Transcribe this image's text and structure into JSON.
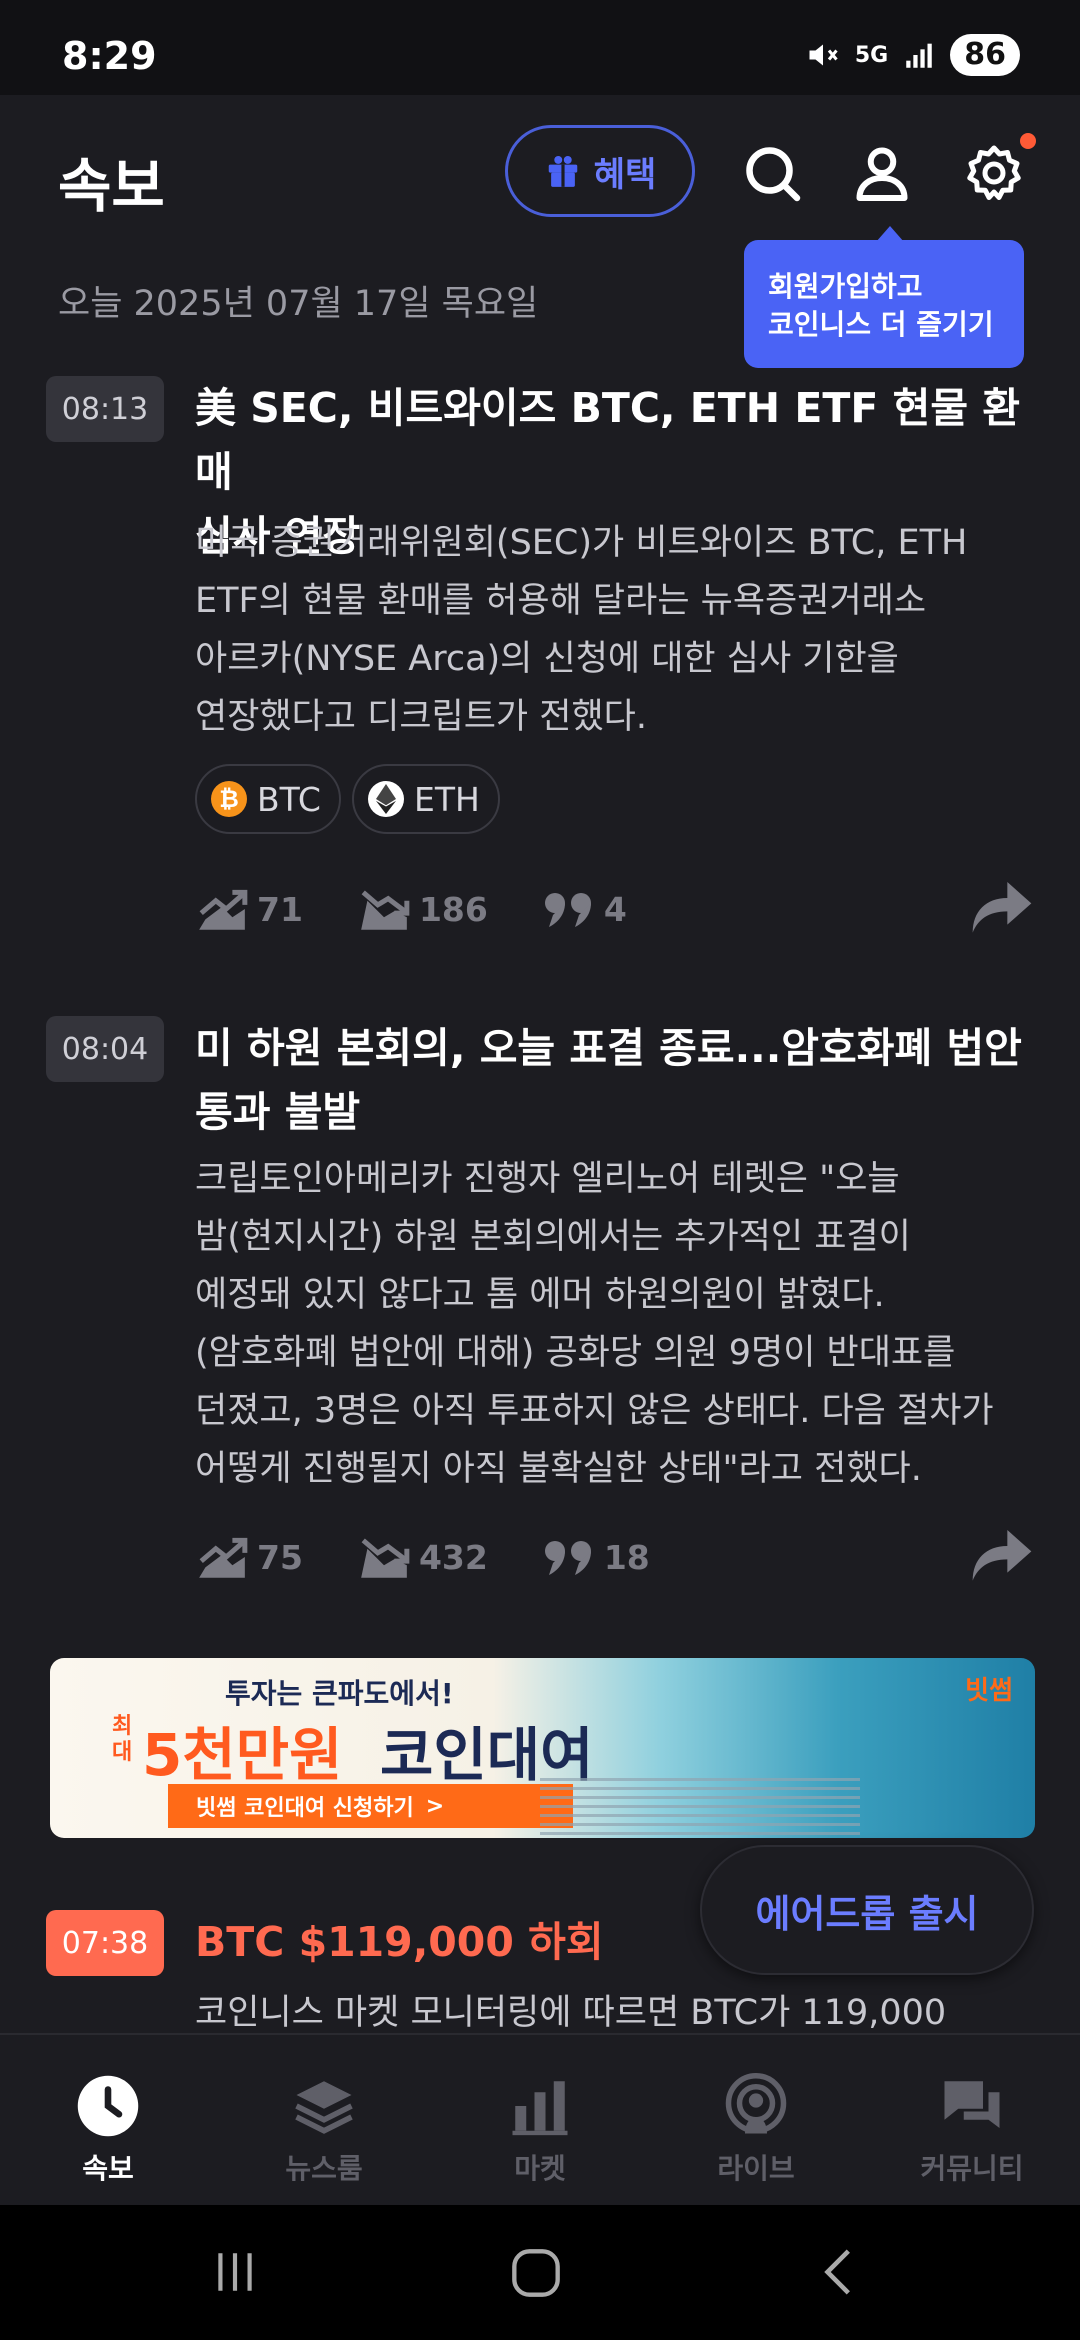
{
  "status_bar": {
    "time": "8:29",
    "network": "5G",
    "battery": "86"
  },
  "header": {
    "title": "속보",
    "benefit_label": "혜택"
  },
  "tooltip": {
    "line1": "회원가입하고",
    "line2": "코인니스 더 즐기기"
  },
  "date_line": "오늘 2025년 07월 17일 목요일",
  "news": [
    {
      "time": "08:13",
      "title_line1": "美 SEC, 비트와이즈 BTC, ETH ETF 현물 환매",
      "title_line2": "심사 연장",
      "body_lines": [
        "미국 증권거래위원회(SEC)가 비트와이즈 BTC, ETH",
        "ETF의 현물 환매를 허용해 달라는 뉴욕증권거래소",
        "아르카(NYSE Arca)의 신청에 대한 심사 기한을",
        "연장했다고 디크립트가 전했다."
      ],
      "coins": [
        "BTC",
        "ETH"
      ],
      "bullish": "71",
      "bearish": "186",
      "comments": "4"
    },
    {
      "time": "08:04",
      "title_line1": "미 하원 본회의, 오늘 표결 종료...암호화폐 법안",
      "title_line2": "통과 불발",
      "body_lines": [
        "크립토인아메리카 진행자 엘리노어 테렛은 \"오늘",
        "밤(현지시간) 하원 본회의에서는 추가적인 표결이",
        "예정돼 있지 않다고 톰 에머 하원의원이 밝혔다.",
        "(암호화폐 법안에 대해) 공화당 의원 9명이 반대표를",
        "던졌고, 3명은 아직 투표하지 않은 상태다. 다음 절차가",
        "어떻게 진행될지 아직 불확실한 상태\"라고 전했다."
      ],
      "bullish": "75",
      "bearish": "432",
      "comments": "18"
    },
    {
      "time": "07:38",
      "title_line1": "BTC $119,000 하회",
      "body_line1": "코인니스 마켓 모니터링에 따르면 BTC가 119,000"
    }
  ],
  "ad": {
    "top_text": "투자는 큰파도에서!",
    "small_text": [
      "최",
      "대"
    ],
    "main_text": "5천만원",
    "main_text2": "코인대여",
    "cta": "빗썸 코인대여 신청하기",
    "cta_arrow": ">",
    "brand": "빗썸"
  },
  "float_button": "에어드롭 출시",
  "bottom_nav": [
    {
      "label": "속보",
      "icon": "clock-icon",
      "active": true
    },
    {
      "label": "뉴스룸",
      "icon": "layers-icon",
      "active": false
    },
    {
      "label": "마켓",
      "icon": "bar-chart-icon",
      "active": false
    },
    {
      "label": "라이브",
      "icon": "broadcast-icon",
      "active": false
    },
    {
      "label": "커뮤니티",
      "icon": "chat-icon",
      "active": false
    }
  ],
  "colors": {
    "accent_blue": "#4a63f5",
    "hot_orange": "#ff6a50",
    "background": "#1c1c21"
  }
}
